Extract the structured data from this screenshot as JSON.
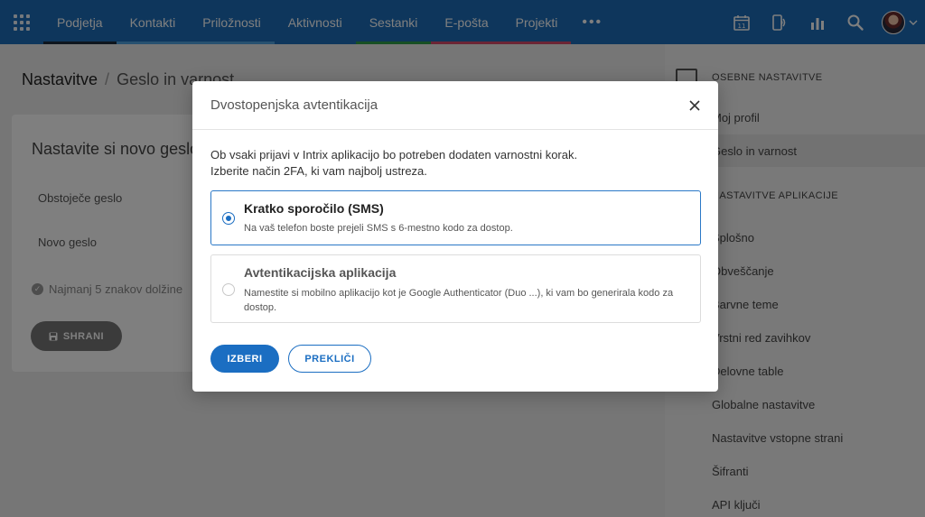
{
  "topnav": {
    "items": [
      {
        "label": "Podjetja",
        "color": "#1a2b3c"
      },
      {
        "label": "Kontakti",
        "color": "#4fa3e0"
      },
      {
        "label": "Priložnosti",
        "color": "#4fa3e0"
      },
      {
        "label": "Aktivnosti",
        "color": "#1d6db8"
      },
      {
        "label": "Sestanki",
        "color": "#2e9e48"
      },
      {
        "label": "E-pošta",
        "color": "#d64a6b"
      },
      {
        "label": "Projekti",
        "color": "#d64a6b"
      }
    ],
    "more_label": "•••",
    "calendar_day": "11"
  },
  "breadcrumb": {
    "root": "Nastavitve",
    "separator": "/",
    "current": "Geslo in varnost"
  },
  "form": {
    "title": "Nastavite si novo geslo",
    "current_password_label": "Obstoječe geslo",
    "new_password_label": "Novo geslo",
    "hint": "Najmanj 5 znakov dolžine",
    "save_label": "SHRANI"
  },
  "sidebar": {
    "section_personal": "OSEBNE NASTAVITVE",
    "personal_items": [
      "Moj profil",
      "Geslo in varnost"
    ],
    "section_app": "NASTAVITVE APLIKACIJE",
    "app_items": [
      "Splošno",
      "Obveščanje",
      "Barvne teme",
      "Vrstni red zavihkov",
      "Delovne table",
      "Globalne nastavitve",
      "Nastavitve vstopne strani",
      "Šifranti",
      "API ključi"
    ]
  },
  "modal": {
    "title": "Dvostopenjska avtentikacija",
    "desc_line1": "Ob vsaki prijavi v Intrix aplikacijo bo potreben dodaten varnostni korak.",
    "desc_line2": "Izberite način 2FA, ki vam najbolj ustreza.",
    "options": [
      {
        "title": "Kratko sporočilo (SMS)",
        "desc": "Na vaš telefon boste prejeli SMS s 6-mestno kodo za dostop.",
        "selected": true
      },
      {
        "title": "Avtentikacijska aplikacija",
        "desc": "Namestite si mobilno aplikacijo kot je Google Authenticator (Duo ...), ki vam bo generirala kodo za dostop.",
        "selected": false
      }
    ],
    "confirm_label": "IZBERI",
    "cancel_label": "PREKLIČI"
  },
  "colors": {
    "nav_bg": "#1d6db8",
    "primary": "#1b6ec2"
  }
}
